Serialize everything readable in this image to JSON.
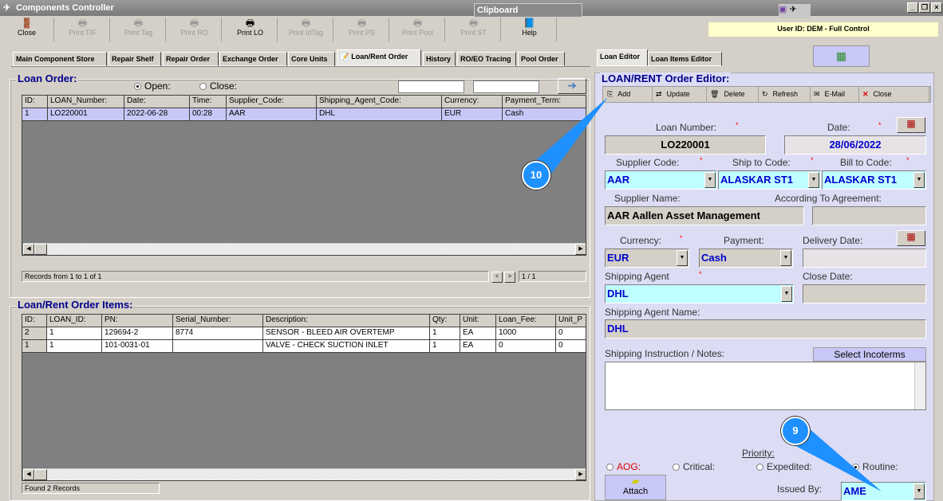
{
  "window": {
    "title": "Components Controller",
    "clipboard": "Clipboard",
    "user": "User ID: DEM - Full Control"
  },
  "toolbar": [
    {
      "label": "Close",
      "icon": "door-icon",
      "enabled": true
    },
    {
      "label": "Print TIF",
      "icon": "printer-icon",
      "enabled": false
    },
    {
      "label": "Print Tag",
      "icon": "printer-icon",
      "enabled": false
    },
    {
      "label": "Print RO",
      "icon": "printer-icon",
      "enabled": false
    },
    {
      "label": "Print LO",
      "icon": "printer-icon",
      "enabled": true
    },
    {
      "label": "Print IdTag",
      "icon": "printer-icon",
      "enabled": false
    },
    {
      "label": "Print PS",
      "icon": "printer-icon",
      "enabled": false
    },
    {
      "label": "Print Pool",
      "icon": "printer-icon",
      "enabled": false
    },
    {
      "label": "Print ST",
      "icon": "printer-icon",
      "enabled": false
    },
    {
      "label": "Help",
      "icon": "help-book-icon",
      "enabled": true
    }
  ],
  "tabs": [
    "Main Component Store",
    "Repair Shelf",
    "Repair Order",
    "Exchange Order",
    "Core Units",
    "Loan/Rent Order",
    "History",
    "RO/EO Tracing",
    "Pool Order"
  ],
  "loan_order": {
    "title": "Loan Order:",
    "open_label": "Open:",
    "close_label": "Close:",
    "filter": "open",
    "columns": [
      "ID:",
      "LOAN_Number:",
      "Date:",
      "Time:",
      "Supplier_Code:",
      "Shipping_Agent_Code:",
      "Currency:",
      "Payment_Term:"
    ],
    "rows": [
      [
        "1",
        "LO220001",
        "2022-06-28",
        "00:28",
        "AAR",
        "DHL",
        "EUR",
        "Cash"
      ]
    ],
    "records": "Records from 1 to 1 of 1",
    "prev": "<",
    "next": ">",
    "page": "1 / 1"
  },
  "items": {
    "title": "Loan/Rent Order Items:",
    "columns": [
      "ID:",
      "LOAN_ID:",
      "PN:",
      "Serial_Number:",
      "Description:",
      "Qty:",
      "Unit:",
      "Loan_Fee:",
      "Unit_P"
    ],
    "rows": [
      [
        "2",
        "1",
        "129694-2",
        "8774",
        "SENSOR - BLEED AIR OVERTEMP",
        "1",
        "EA",
        "1000",
        "0"
      ],
      [
        "1",
        "1",
        "101-0031-01",
        "",
        "VALVE - CHECK SUCTION INLET",
        "1",
        "EA",
        "0",
        "0"
      ]
    ],
    "found": "Found 2 Records"
  },
  "editor_tabs": [
    "Loan Editor",
    "Loan Items Editor"
  ],
  "editor": {
    "title": "LOAN/RENT Order Editor:",
    "toolbar": [
      "Add",
      "Update",
      "Delete",
      "Refresh",
      "E-Mail",
      "Close"
    ],
    "loan_number_label": "Loan Number:",
    "loan_number": "LO220001",
    "date_label": "Date:",
    "date": "28/06/2022",
    "supplier_code_label": "Supplier Code:",
    "supplier_code": "AAR",
    "ship_to_label": "Ship to Code:",
    "ship_to": "ALASKAR ST1",
    "bill_to_label": "Bill to Code:",
    "bill_to": "ALASKAR ST1",
    "supplier_name_label": "Supplier Name:",
    "supplier_name": "AAR Aallen Asset Management",
    "agreement_label": "According To Agreement:",
    "agreement": "",
    "currency_label": "Currency:",
    "currency": "EUR",
    "payment_label": "Payment:",
    "payment": "Cash",
    "delivery_label": "Delivery Date:",
    "delivery": "",
    "agent_label": "Shipping Agent",
    "agent": "DHL",
    "close_date_label": "Close Date:",
    "close_date": "",
    "agent_name_label": "Shipping Agent Name:",
    "agent_name": "DHL",
    "notes_label": "Shipping Instruction / Notes:",
    "notes": "",
    "incoterms": "Select Incoterms",
    "priority_label": "Priority:",
    "priorities": [
      "AOG:",
      "Critical:",
      "Expedited:",
      "Routine:"
    ],
    "priority_selected": "Routine:",
    "attach": "Attach",
    "issued_label": "Issued By:",
    "issued": "AME",
    "required": "*"
  },
  "callouts": [
    "10",
    "9"
  ],
  "colors": {
    "accent": "#1e90ff",
    "selected_row": "#c8c8f8",
    "editor_bg": "#dcdcf4"
  }
}
